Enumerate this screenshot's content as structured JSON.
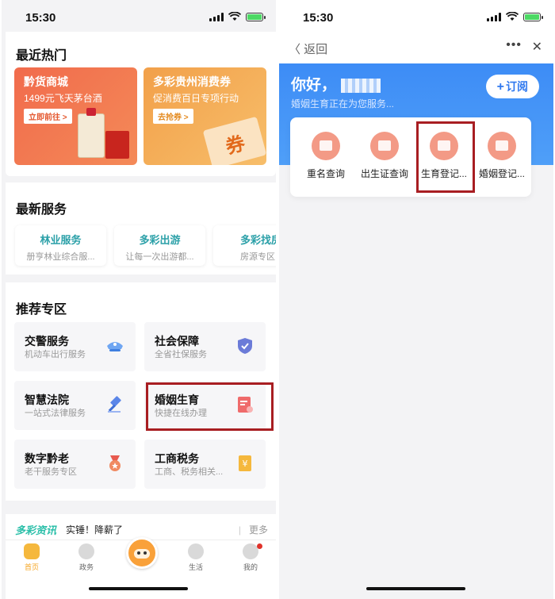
{
  "status": {
    "time_left": "15:30",
    "time_right": "15:30"
  },
  "home": {
    "hot": {
      "title": "最近热门",
      "banners": [
        {
          "title": "黔货商城",
          "sub": "1499元飞天茅台酒",
          "button": "立即前往 >"
        },
        {
          "title": "多彩贵州消费券",
          "sub": "促消费百日专项行动",
          "button": "去抢券 >",
          "art_text": "券"
        }
      ]
    },
    "new_services": {
      "title": "最新服务",
      "items": [
        {
          "title": "林业服务",
          "sub": "册亨林业综合服..."
        },
        {
          "title": "多彩出游",
          "sub": "让每一次出游都..."
        },
        {
          "title": "多彩找房",
          "sub": "房源专区"
        }
      ]
    },
    "recommended": {
      "title": "推荐专区",
      "tiles": [
        {
          "title": "交警服务",
          "sub": "机动车出行服务",
          "icon": "police-cap-icon",
          "color": "#6fa6f2"
        },
        {
          "title": "社会保障",
          "sub": "全省社保服务",
          "icon": "shield-icon",
          "color": "#6b7bd8"
        },
        {
          "title": "智慧法院",
          "sub": "一站式法律服务",
          "icon": "gavel-icon",
          "color": "#5b86e8"
        },
        {
          "title": "婚姻生育",
          "sub": "快捷在线办理",
          "icon": "document-heart-icon",
          "color": "#ef6b6b"
        },
        {
          "title": "数字黔老",
          "sub": "老干服务专区",
          "icon": "medal-icon",
          "color": "#e85a4f"
        },
        {
          "title": "工商税务",
          "sub": "工商、税务相关...",
          "icon": "tax-document-icon",
          "color": "#f5b83d"
        }
      ]
    },
    "news": {
      "logo": "多彩资讯",
      "headline": "实锤！降薪了",
      "more": "更多"
    },
    "tabs": [
      {
        "label": "首页",
        "icon": "home-icon"
      },
      {
        "label": "政务",
        "icon": "government-icon"
      },
      {
        "label": "",
        "icon": "mascot-icon"
      },
      {
        "label": "生活",
        "icon": "planet-icon"
      },
      {
        "label": "我的",
        "icon": "user-icon"
      }
    ]
  },
  "detail": {
    "nav": {
      "back": "返回",
      "more": "•••",
      "close": "✕"
    },
    "greeting": "你好，",
    "subtitle": "婚姻生育正在为您服务...",
    "subscribe": "订阅",
    "services": [
      {
        "label": "重名查询",
        "icon": "id-card-icon"
      },
      {
        "label": "出生证查询",
        "icon": "certificate-icon"
      },
      {
        "label": "生育登记...",
        "icon": "pregnant-woman-icon"
      },
      {
        "label": "婚姻登记...",
        "icon": "couple-icon"
      }
    ]
  }
}
